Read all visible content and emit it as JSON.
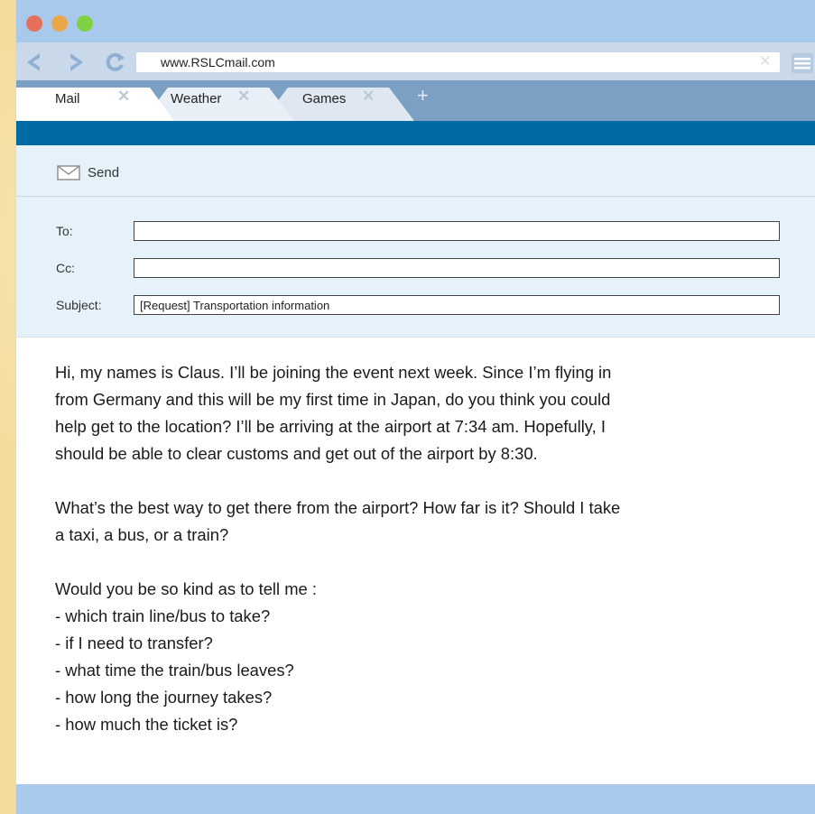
{
  "browser": {
    "url": "www.RSLCmail.com",
    "tabs": [
      {
        "label": "Mail"
      },
      {
        "label": "Weather"
      },
      {
        "label": "Games"
      }
    ],
    "new_tab_symbol": "+",
    "close_symbol": "✕"
  },
  "toolbar": {
    "send_label": "Send"
  },
  "fields": {
    "to_label": "To:",
    "to_value": "",
    "cc_label": "Cc:",
    "cc_value": "",
    "subject_label": "Subject:",
    "subject_value": "[Request] Transportation information"
  },
  "message": {
    "paragraph_1_lines": [
      "Hi, my names is Claus. I’ll be joining the event next week. Since I’m flying in",
      "from Germany and this will be my first time in Japan, do you think you could",
      "help get to the location? I’ll be arriving at the airport at 7:34 am. Hopefully, I",
      "should be able to clear customs and get out of the airport by 8:30."
    ],
    "paragraph_2_lines": [
      "What’s the best way to get there from the airport? How far is it? Should I take",
      "a taxi, a bus, or a train?"
    ],
    "paragraph_3_lines": [
      "Would you be so kind as to tell me :",
      "- which train line/bus to take?",
      "- if I need to transfer?",
      "- what time the train/bus leaves?",
      "- how long the journey takes?",
      "- how much the ticket is?"
    ]
  },
  "colors": {
    "titlebar": "#a9c9ec",
    "tabbar": "#7c9fc4",
    "accent_strip": "#006aa4",
    "compose_bg": "#e6f2fa"
  }
}
